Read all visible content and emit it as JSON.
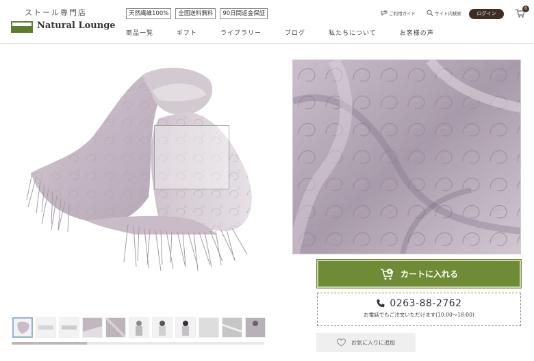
{
  "header": {
    "logo_sub": "ストール専門店",
    "logo_text": "Natural Lounge",
    "badges": [
      "天然繊維100%",
      "全国送料無料",
      "90日間返金保証"
    ],
    "nav": [
      "商品一覧",
      "ギフト",
      "ライブラリー",
      "ブログ",
      "私たちについて",
      "お客様の声"
    ],
    "guide_label": "ご利用ガイド",
    "search_label": "サイト内検索",
    "login_label": "ログイン",
    "cart_count": "0"
  },
  "product": {
    "thumbnail_count": 11,
    "active_thumbnail": 0,
    "cart_button_label": "カートに入れる",
    "phone_number": "0263-88-2762",
    "phone_note": "お電話でもご注文いただけます(10:00～18:00)",
    "favorite_label": "お気に入りに追加"
  },
  "colors": {
    "brand_green": "#6f8b36",
    "login_brown": "#3e2f22",
    "scarf_lavender": "#b8acba"
  }
}
